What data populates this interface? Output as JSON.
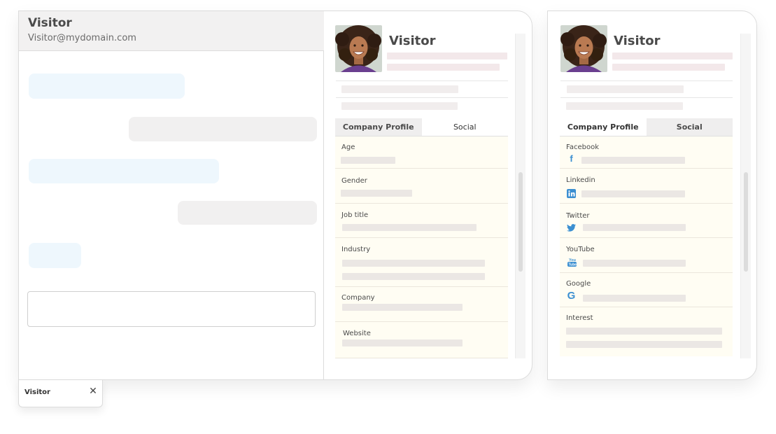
{
  "chat": {
    "visitor_name": "Visitor",
    "visitor_email": "Visitor@mydomain.com"
  },
  "profile_left": {
    "name": "Visitor",
    "tabs": [
      "Company Profile",
      "Social"
    ],
    "selected_tab": "Social",
    "fields": [
      "Age",
      "Gender",
      "Job title",
      "Industry",
      "Company",
      "Website"
    ]
  },
  "profile_right": {
    "name": "Visitor",
    "tabs": [
      "Company Profile",
      "Social"
    ],
    "selected_tab": "Social",
    "socials": [
      {
        "label": "Facebook",
        "icon": "facebook-icon"
      },
      {
        "label": "Linkedin",
        "icon": "linkedin-icon"
      },
      {
        "label": "Twitter",
        "icon": "twitter-icon"
      },
      {
        "label": "YouTube",
        "icon": "youtube-icon"
      },
      {
        "label": "Google",
        "icon": "google-icon"
      }
    ],
    "interest_label": "Interest"
  },
  "minimized_chat": {
    "label": "Visitor",
    "close_glyph": "✕"
  },
  "colors": {
    "incoming_bubble": "#eef7fd",
    "outgoing_bubble": "#f1f0f0",
    "field_background": "#fffdf3",
    "social_icon": "#3b8fd1"
  }
}
